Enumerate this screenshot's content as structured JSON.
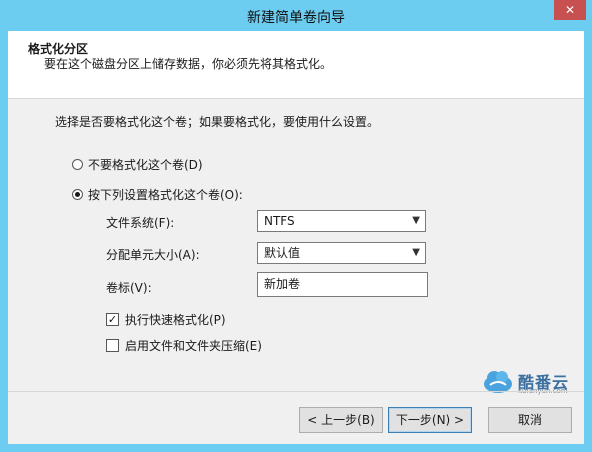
{
  "window": {
    "title": "新建简单卷向导",
    "close_label": "✕"
  },
  "header": {
    "title": "格式化分区",
    "subtitle": "要在这个磁盘分区上储存数据，你必须先将其格式化。"
  },
  "main": {
    "prompt": "选择是否要格式化这个卷；如果要格式化，要使用什么设置。",
    "options": [
      {
        "label": "不要格式化这个卷(D)",
        "checked": false
      },
      {
        "label": "按下列设置格式化这个卷(O):",
        "checked": true
      }
    ],
    "fields": {
      "filesystem_label": "文件系统(F):",
      "filesystem_value": "NTFS",
      "alloc_label": "分配单元大小(A):",
      "alloc_value": "默认值",
      "volume_label": "卷标(V):",
      "volume_value": "新加卷"
    },
    "checkboxes": [
      {
        "label": "执行快速格式化(P)",
        "checked": true
      },
      {
        "label": "启用文件和文件夹压缩(E)",
        "checked": false
      }
    ]
  },
  "buttons": {
    "back": "< 上一步(B)",
    "next": "下一步(N) >",
    "cancel": "取消"
  },
  "watermark": {
    "name": "酷番云",
    "url": "kufanyun.com"
  },
  "colors": {
    "titlebar": "#6ccdf1",
    "close": "#c75050",
    "client": "#f0f0f0"
  }
}
